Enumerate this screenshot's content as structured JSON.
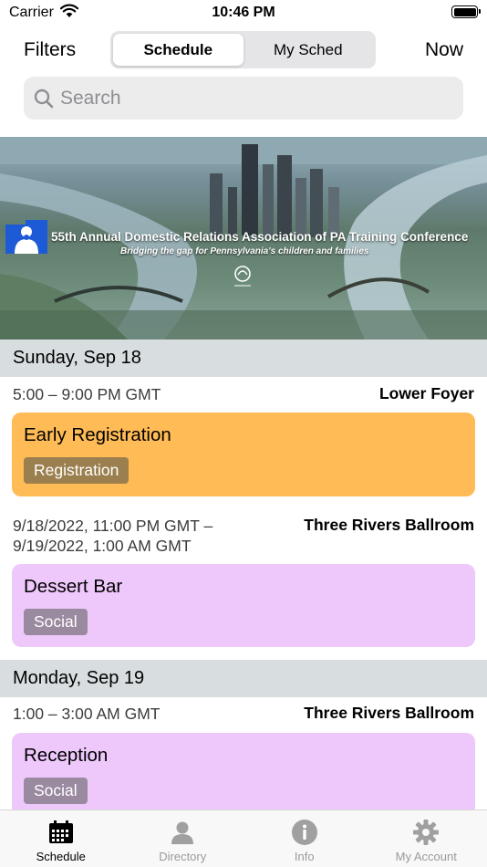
{
  "status_bar": {
    "carrier": "Carrier",
    "time": "10:46 PM"
  },
  "nav": {
    "filters_label": "Filters",
    "segments": [
      "Schedule",
      "My Sched"
    ],
    "active_segment": "Schedule",
    "now_label": "Now"
  },
  "search": {
    "placeholder": "Search",
    "icon": "magnifier-icon"
  },
  "banner": {
    "title": "55th Annual Domestic Relations Association of PA Training Conference",
    "subtitle": "Bridging the gap for Pennsylvania's children and families"
  },
  "days": [
    {
      "header": "Sunday, Sep 18",
      "events": [
        {
          "time": "5:00 – 9:00 PM GMT",
          "room": "Lower Foyer",
          "title": "Early Registration",
          "tag": "Registration",
          "color": "#ffbb55",
          "tag_color": "#9c7f4e"
        },
        {
          "time_line1": "9/18/2022, 11:00 PM GMT –",
          "time_line2": "9/19/2022, 1:00 AM GMT",
          "room": "Three Rivers Ballroom",
          "title": "Dessert Bar",
          "tag": "Social",
          "color": "#eec8fb",
          "tag_color": "#9a8aa0"
        }
      ]
    },
    {
      "header": "Monday, Sep 19",
      "events": [
        {
          "time": "1:00 – 3:00 AM GMT",
          "room": "Three Rivers Ballroom",
          "title": "Reception",
          "tag": "Social",
          "color": "#eec8fb",
          "tag_color": "#9a8aa0"
        }
      ]
    }
  ],
  "tab_bar": {
    "tabs": [
      {
        "label": "Schedule",
        "icon": "calendar-icon",
        "active": true
      },
      {
        "label": "Directory",
        "icon": "person-icon",
        "active": false
      },
      {
        "label": "Info",
        "icon": "info-icon",
        "active": false
      },
      {
        "label": "My Account",
        "icon": "gear-icon",
        "active": false
      }
    ]
  }
}
